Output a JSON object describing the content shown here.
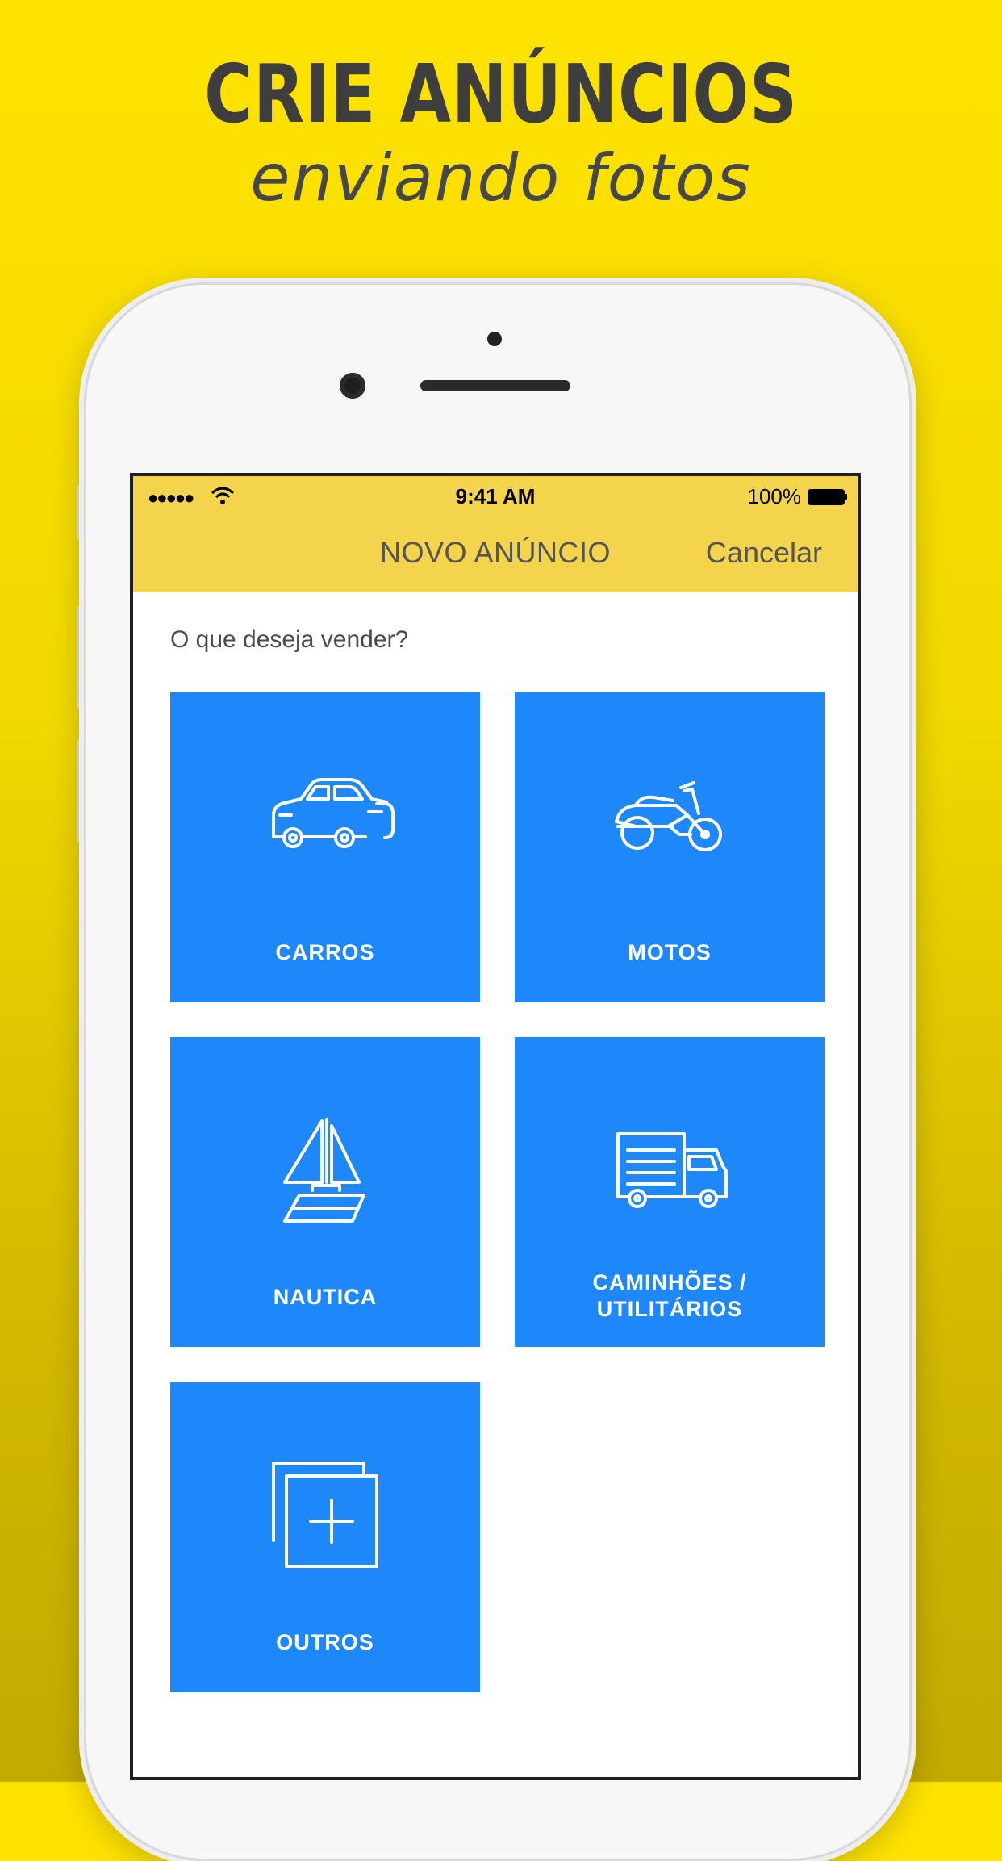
{
  "promo": {
    "headline": "CRIE ANÚNCIOS",
    "subheadline": "enviando fotos"
  },
  "colors": {
    "background": "#ffe300",
    "navbar": "#f4d44d",
    "tile": "#1e88fa",
    "tile_text": "#ffffff"
  },
  "status_bar": {
    "signal": "●●●●●",
    "time": "9:41 AM",
    "battery": "100%"
  },
  "nav": {
    "title": "NOVO ANÚNCIO",
    "cancel": "Cancelar"
  },
  "prompt": "O que deseja vender?",
  "categories": [
    {
      "label": "CARROS",
      "icon": "car-icon"
    },
    {
      "label": "MOTOS",
      "icon": "motorcycle-icon"
    },
    {
      "label": "NAUTICA",
      "icon": "sailboat-icon"
    },
    {
      "label_line1": "CAMINHÕES /",
      "label_line2": "UTILITÁRIOS",
      "icon": "truck-icon"
    },
    {
      "label": "OUTROS",
      "icon": "add-pages-icon"
    }
  ]
}
